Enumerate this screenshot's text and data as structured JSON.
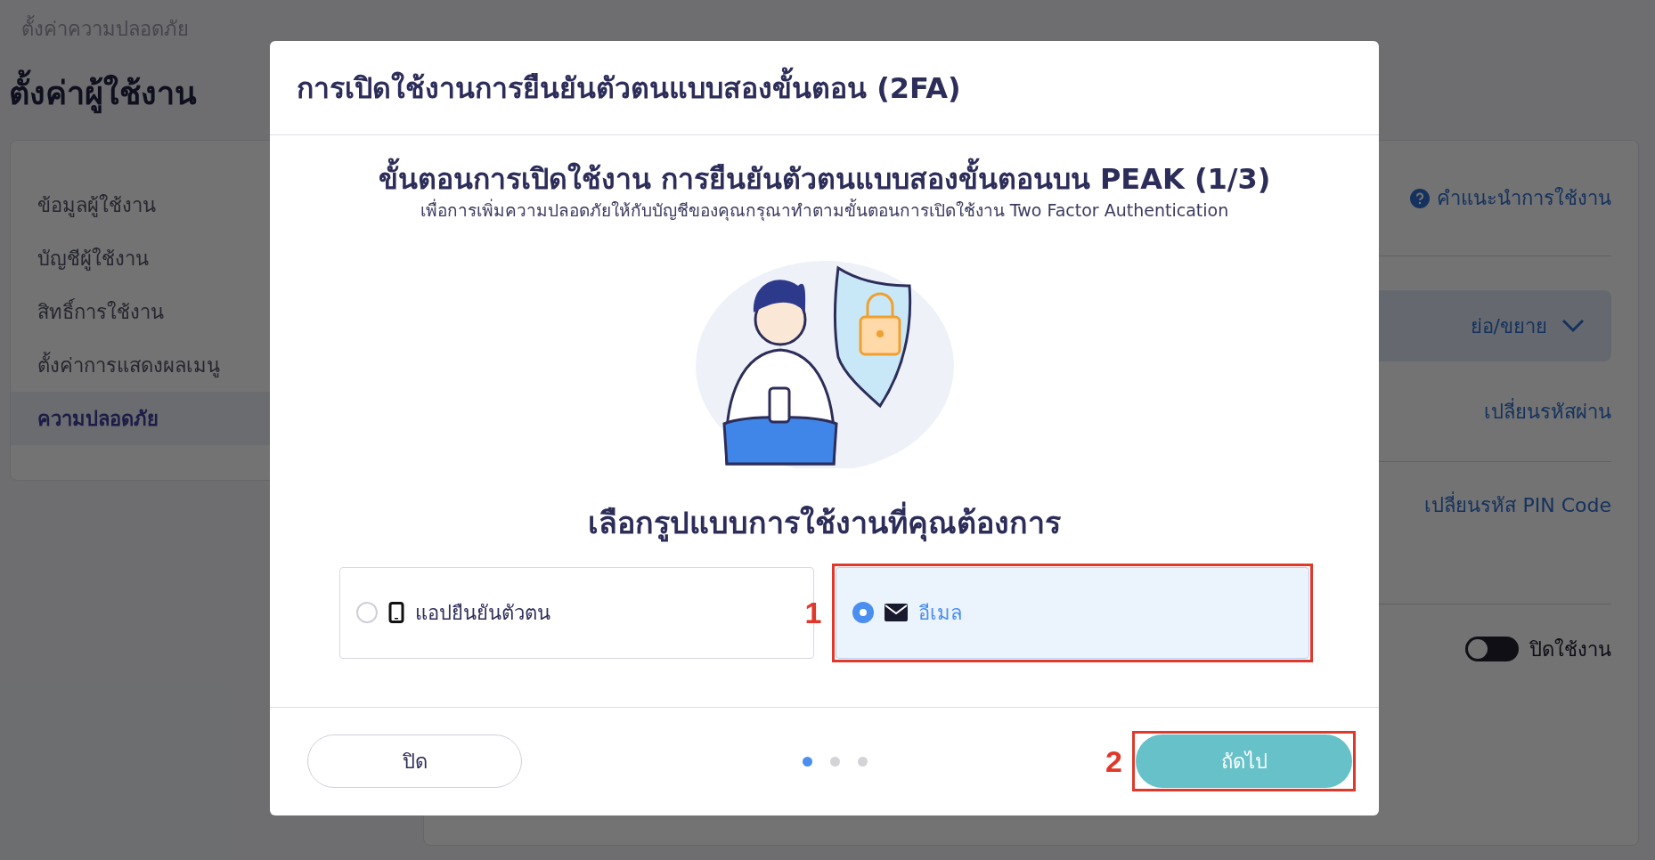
{
  "breadcrumb": "ตั้งค่าความปลอดภัย",
  "page_title": "ตั้งค่าผู้ใช้งาน",
  "sidebar": {
    "items": [
      {
        "label": "ข้อมูลผู้ใช้งาน",
        "selected": false
      },
      {
        "label": "บัญชีผู้ใช้งาน",
        "selected": false
      },
      {
        "label": "สิทธิ์การใช้งาน",
        "selected": false
      },
      {
        "label": "ตั้งค่าการแสดงผลเมนู",
        "selected": false
      },
      {
        "label": "ความปลอดภัย",
        "selected": true
      }
    ]
  },
  "settings_panel": {
    "help_link": "คำแนะนำการใช้งาน",
    "collapse_toggle": "ย่อ/ขยาย",
    "change_password_link": "เปลี่ยนรหัสผ่าน",
    "change_pin_link": "เปลี่ยนรหัส PIN Code",
    "two_factor_switch": {
      "label": "ปิดใช้งาน",
      "on": false
    }
  },
  "dialog": {
    "title": "การเปิดใช้งานการยืนยันตัวตนแบบสองขั้นตอน (2FA)",
    "step_title": "ขั้นตอนการเปิดใช้งาน การยืนยันตัวตนแบบสองขั้นตอนบน PEAK (1/3)",
    "step_description": "เพื่อการเพิ่มความปลอดภัยให้กับบัญชีของคุณกรุณาทำตามขั้นตอนการเปิดใช้งาน Two Factor Authentication",
    "choice_heading": "เลือกรูปแบบการใช้งานที่คุณต้องการ",
    "options": [
      {
        "kind": "app",
        "label": "แอปยืนยันตัวตน",
        "selected": false
      },
      {
        "kind": "email",
        "label": "อีเมล",
        "selected": true
      }
    ],
    "steps": [
      {
        "selected": true
      },
      {
        "selected": false
      },
      {
        "selected": false
      }
    ],
    "close_button": "ปิด",
    "next_button": "ถัดไป"
  },
  "annotations": [
    {
      "label": "1",
      "kind": "selected-option"
    },
    {
      "label": "2",
      "kind": "next-button"
    }
  ]
}
